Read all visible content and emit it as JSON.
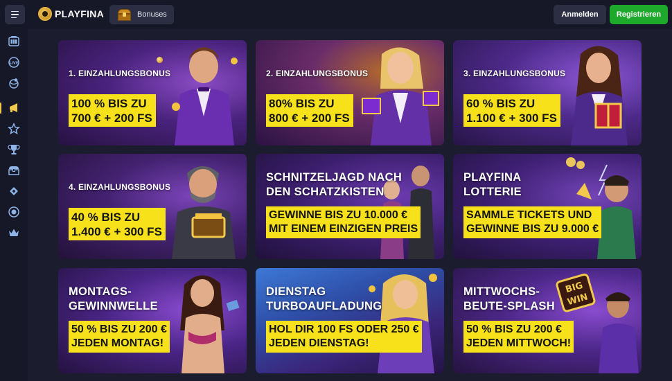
{
  "header": {
    "brand": "PLAYFINA",
    "bonuses_label": "Bonuses",
    "login_label": "Anmelden",
    "register_label": "Registrieren"
  },
  "sidebar": {
    "items": [
      {
        "icon": "slots-icon"
      },
      {
        "icon": "live-icon"
      },
      {
        "icon": "sports-icon"
      },
      {
        "icon": "megaphone-icon",
        "active": true
      },
      {
        "icon": "star-icon"
      },
      {
        "icon": "trophy-icon"
      },
      {
        "icon": "chest-icon"
      },
      {
        "icon": "ticket-icon"
      },
      {
        "icon": "vip-badge-icon"
      },
      {
        "icon": "crown-icon"
      }
    ]
  },
  "colors": {
    "offer_bg": "#f6e11a",
    "register_green": "#1fa92c",
    "sidebar_active": "#f2c94c"
  },
  "promos": [
    {
      "title": "1. EINZAHLUNGSBONUS",
      "offer": [
        "100 % BIS ZU",
        "700 € + 200 FS"
      ]
    },
    {
      "title": "2. EINZAHLUNGSBONUS",
      "offer": [
        "80% BIS ZU",
        "800 € + 200 FS"
      ]
    },
    {
      "title": "3. EINZAHLUNGSBONUS",
      "offer": [
        "60 % BIS ZU",
        "1.100 € + 300 FS"
      ]
    },
    {
      "title": "4. EINZAHLUNGSBONUS",
      "offer": [
        "40 % BIS ZU",
        "1.400 € + 300 FS"
      ]
    },
    {
      "title": [
        "SCHNITZELJAGD NACH",
        "DEN  SCHATZKISTEN"
      ],
      "offer": [
        "GEWINNE BIS ZU 10.000 €",
        "MIT EINEM EINZIGEN PREIS"
      ]
    },
    {
      "title": [
        "PLAYFINA",
        "LOTTERIE"
      ],
      "offer": [
        "SAMMLE TICKETS UND",
        "GEWINNE BIS ZU 9.000 €"
      ]
    },
    {
      "title": [
        "MONTAGS-",
        "GEWINNWELLE"
      ],
      "offer": [
        "50 % BIS ZU 200 €",
        "JEDEN MONTAG!"
      ]
    },
    {
      "title": [
        "DIENSTAG",
        "TURBOAUFLADUNG"
      ],
      "offer": [
        "HOL DIR 100 FS ODER 250 €",
        "JEDEN DIENSTAG!"
      ]
    },
    {
      "title": [
        "MITTWOCHS-",
        "BEUTE-SPLASH"
      ],
      "offer": [
        "50 % BIS ZU 200 €",
        "JEDEN MITTWOCH!"
      ],
      "sign": [
        "BIG",
        "WIN"
      ]
    }
  ]
}
